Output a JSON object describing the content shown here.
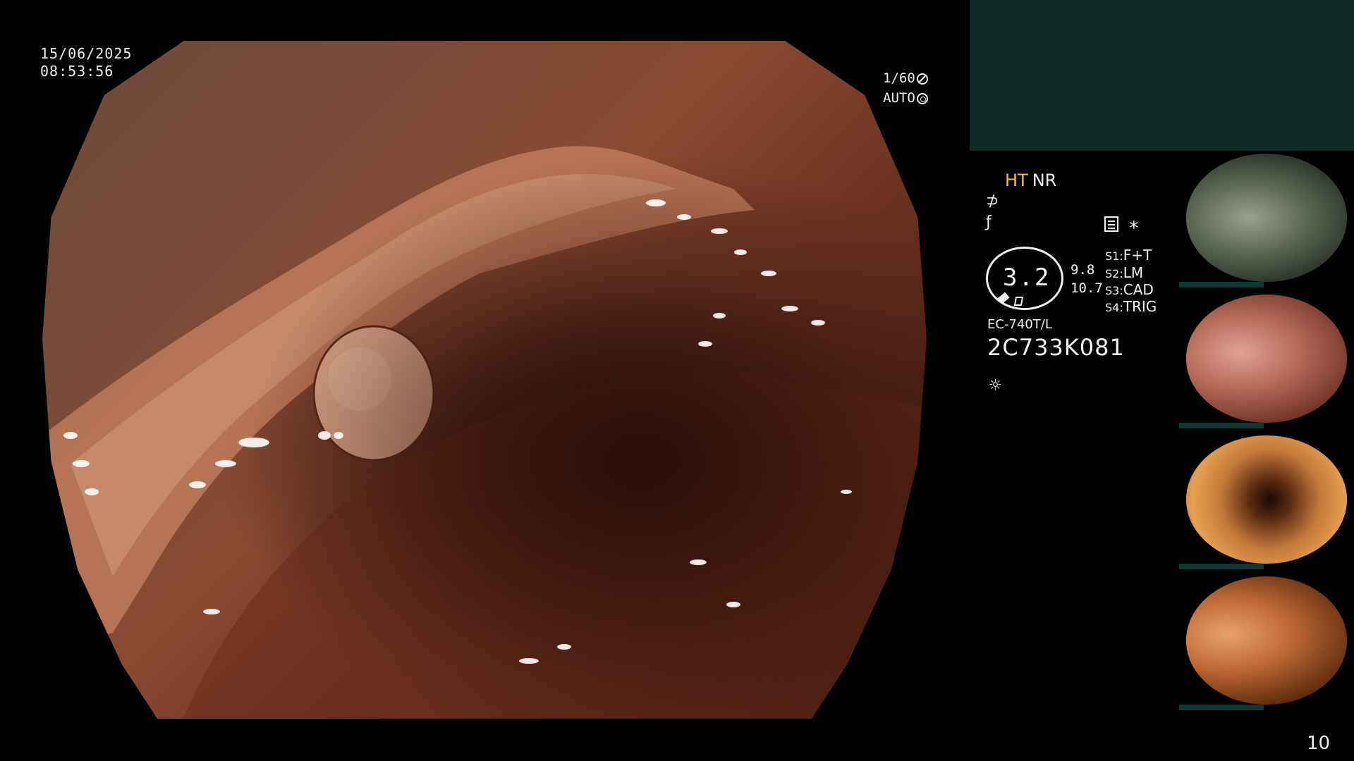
{
  "overlay": {
    "date": "15/06/2025",
    "time": "08:53:56",
    "shutter": "1/60",
    "iris": "AUTO"
  },
  "info": {
    "enhance_a": "HT",
    "enhance_b": "NR",
    "structure_symbol": "⊅",
    "color_symbol": "ƒ",
    "star": "∗",
    "zoom_value": "3.2",
    "zoom_a": "9.8",
    "zoom_b": "10.7",
    "switches": [
      {
        "key": "S1:",
        "label": "F+T"
      },
      {
        "key": "S2:",
        "label": "LM"
      },
      {
        "key": "S3:",
        "label": "CAD"
      },
      {
        "key": "S4:",
        "label": "TRIG"
      }
    ],
    "scope_model": "EC-740T/L",
    "scope_serial": "2C733K081",
    "light_symbol": "☼"
  },
  "thumbnails": [
    "green-cast view of polyp",
    "polyp on fold",
    "lumen view",
    "folded lumen view"
  ],
  "page_number": "10",
  "colors": {
    "accent_yellow": "#f5c02a",
    "panel_teal": "#0f2a27",
    "thumb_bar": "#0f3a34"
  }
}
